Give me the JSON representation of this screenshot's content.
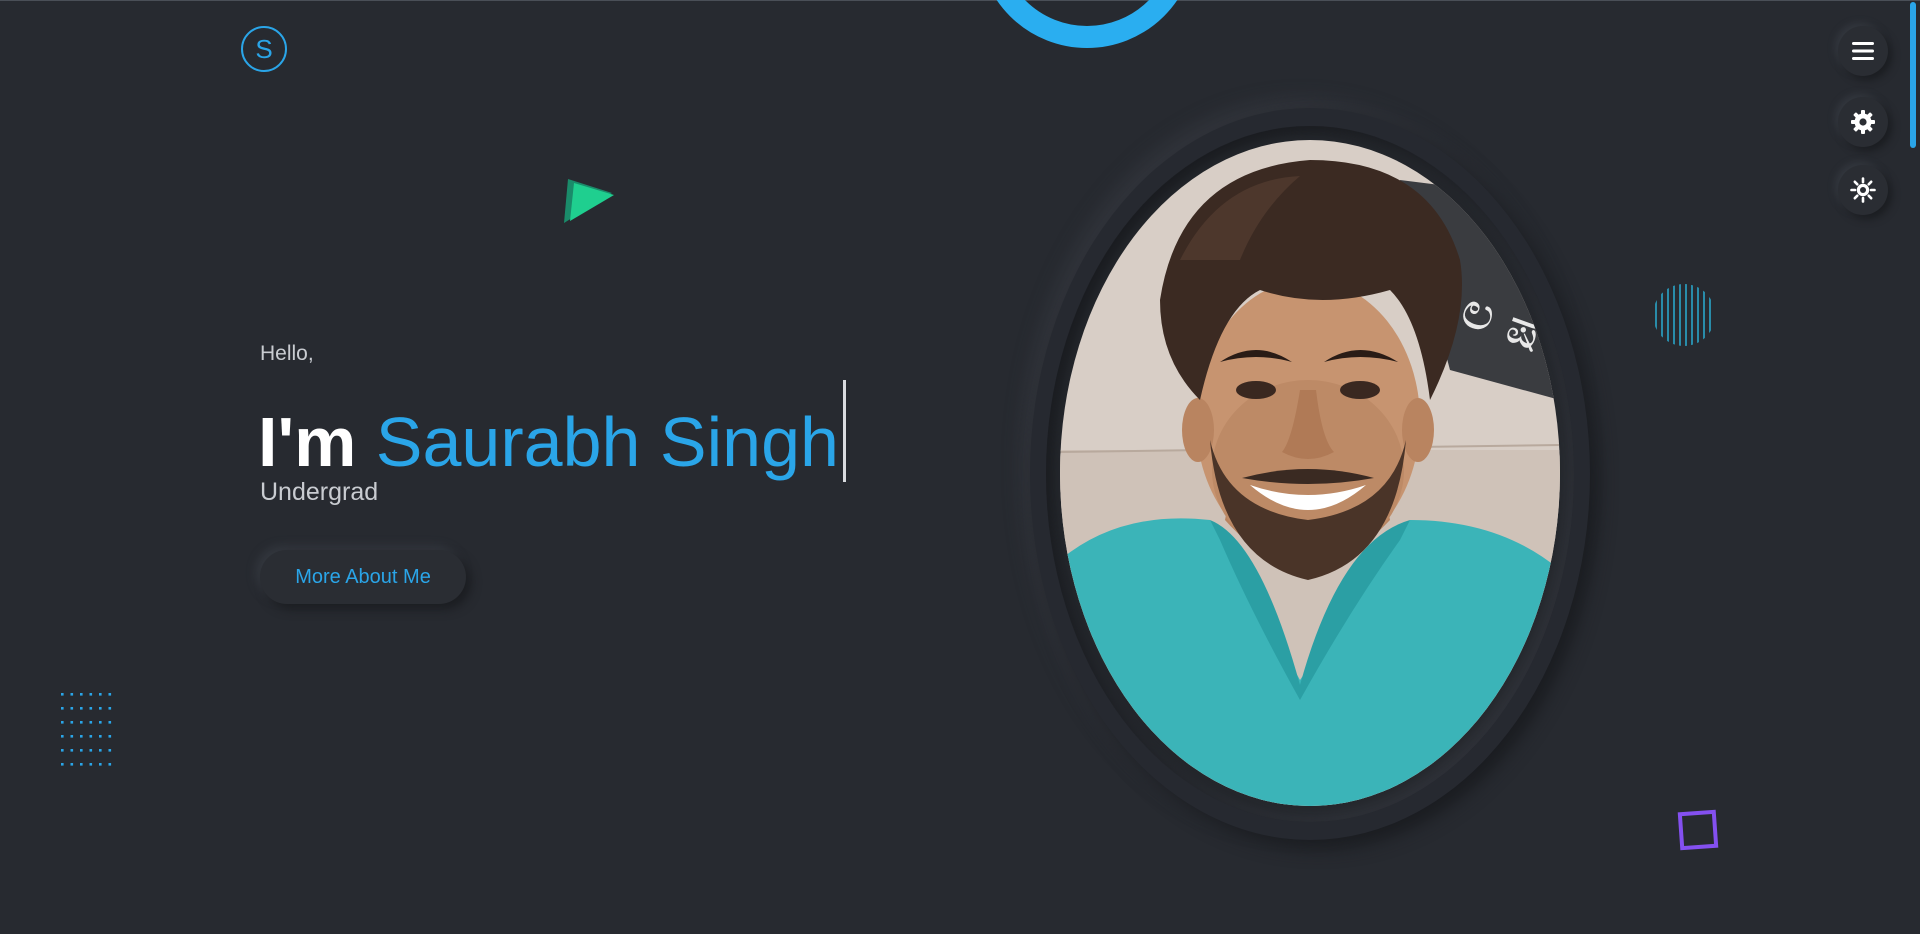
{
  "logo": {
    "letter": "S"
  },
  "hero": {
    "greeting": "Hello,",
    "intro": "I'm",
    "name": "Saurabh Singh",
    "role": "Undergrad",
    "cta_label": "More About Me"
  },
  "colors": {
    "background": "#272a30",
    "accent": "#2aa5e8",
    "accent_green": "#1fcf8f",
    "accent_purple": "#8450f0"
  },
  "side_controls": [
    {
      "icon": "hamburger-menu-icon"
    },
    {
      "icon": "gear-icon"
    },
    {
      "icon": "sun-icon"
    }
  ]
}
